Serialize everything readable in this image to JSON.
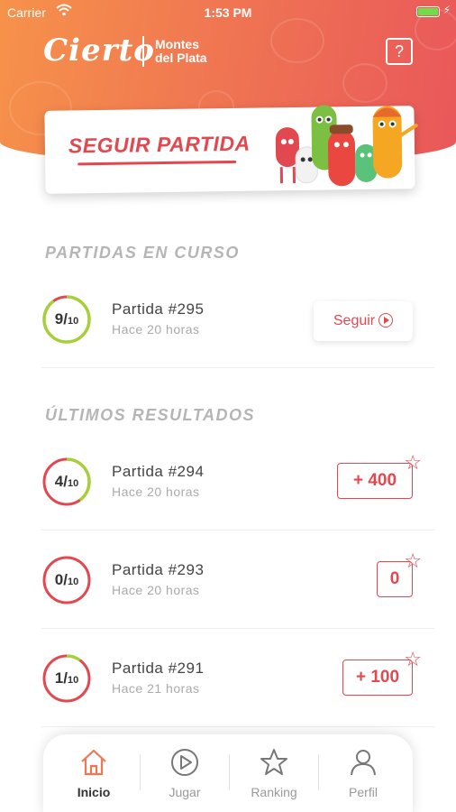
{
  "status_bar": {
    "carrier": "Carrier",
    "time": "1:53 PM"
  },
  "header": {
    "logo": "Cierto",
    "partner_line1": "Montes",
    "partner_line2": "del Plata",
    "help_label": "?"
  },
  "banner": {
    "text": "SEGUIR PARTIDA"
  },
  "in_progress": {
    "title": "PARTIDAS EN CURSO",
    "items": [
      {
        "score": "9",
        "total": "10",
        "progress": 0.9,
        "title": "Partida #295",
        "subtitle": "Hace 20 horas",
        "action_label": "Seguir"
      }
    ]
  },
  "results": {
    "title": "ÚLTIMOS RESULTADOS",
    "items": [
      {
        "score": "4",
        "total": "10",
        "progress": 0.4,
        "title": "Partida #294",
        "subtitle": "Hace 20 horas",
        "points": "+ 400"
      },
      {
        "score": "0",
        "total": "10",
        "progress": 0.0,
        "title": "Partida #293",
        "subtitle": "Hace 20 horas",
        "points": "0"
      },
      {
        "score": "1",
        "total": "10",
        "progress": 0.1,
        "title": "Partida #291",
        "subtitle": "Hace 21 horas",
        "points": "+ 100"
      }
    ]
  },
  "tabbar": {
    "tabs": [
      {
        "label": "Inicio",
        "icon": "home-icon",
        "active": true
      },
      {
        "label": "Jugar",
        "icon": "play-icon",
        "active": false
      },
      {
        "label": "Ranking",
        "icon": "star-icon",
        "active": false
      },
      {
        "label": "Perfil",
        "icon": "user-icon",
        "active": false
      }
    ]
  },
  "colors": {
    "accent": "#e2484f",
    "progress": "#a7cf3a",
    "header_start": "#f6924a",
    "header_end": "#e9575a"
  }
}
